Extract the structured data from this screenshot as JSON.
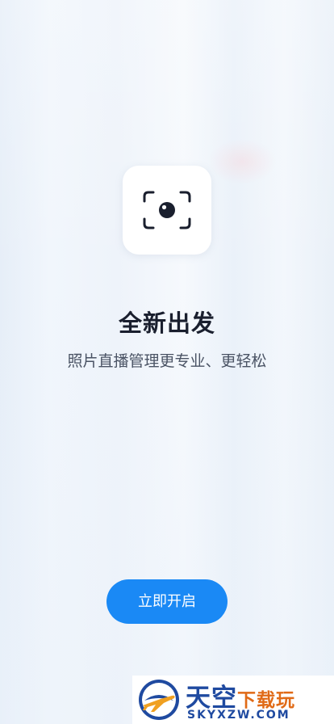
{
  "onboarding": {
    "title": "全新出发",
    "subtitle": "照片直播管理更专业、更轻松",
    "start_button_label": "立即开启",
    "icon": "camera-focus-icon"
  },
  "watermark": {
    "logo_icon": "airplane-globe-logo",
    "brand_primary": "天空",
    "brand_accent": "下载玩",
    "url": "SKYXZW.COM"
  },
  "colors": {
    "accent": "#1a89f5",
    "title": "#1a1f2e",
    "subtitle": "#4a5364",
    "watermark_blue": "#1f4aa0",
    "watermark_orange": "#e06a16"
  }
}
